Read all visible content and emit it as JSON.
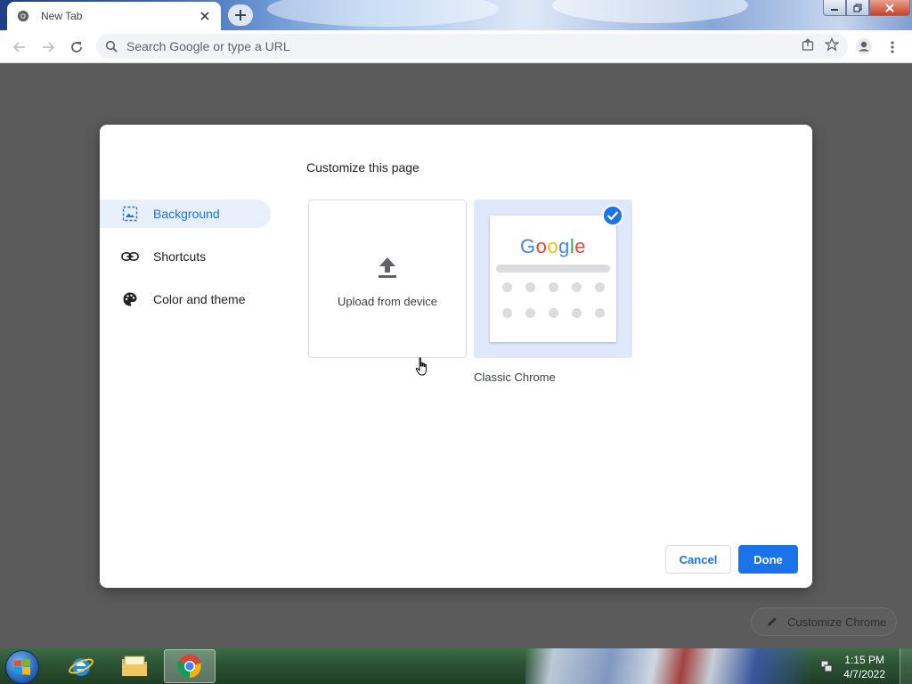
{
  "browser": {
    "tab": {
      "title": "New Tab"
    },
    "omnibox": {
      "placeholder": "Search Google or type a URL"
    }
  },
  "dialog": {
    "title": "Customize this page",
    "menu": [
      {
        "label": "Background",
        "icon": "background-icon",
        "active": true
      },
      {
        "label": "Shortcuts",
        "icon": "link-icon",
        "active": false
      },
      {
        "label": "Color and theme",
        "icon": "palette-icon",
        "active": false
      }
    ],
    "tiles": {
      "upload_label": "Upload from device",
      "classic_label": "Classic Chrome",
      "classic_selected": true,
      "google_logo": "Google"
    },
    "buttons": {
      "cancel": "Cancel",
      "done": "Done"
    }
  },
  "page": {
    "customize_chip": "Customize Chrome"
  },
  "taskbar": {
    "time": "1:15 PM",
    "date": "4/7/2022"
  },
  "colors": {
    "accent": "#1a73e8",
    "accent_light": "#e8f0fe",
    "overlay": "#5b5b5b"
  }
}
